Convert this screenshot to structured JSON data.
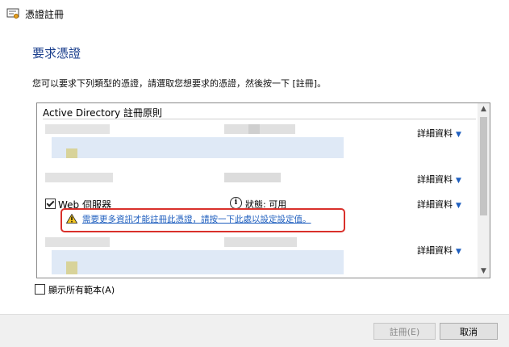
{
  "window": {
    "title": "憑證註冊"
  },
  "page": {
    "heading": "要求憑證",
    "description": "您可以要求下列類型的憑證，請選取您想要求的憑證，然後按一下 [註冊]。"
  },
  "list": {
    "header": "Active Directory 註冊原則",
    "details_label": "詳細資料",
    "web_server": {
      "name": "Web 伺服器",
      "status": "狀態: 可用",
      "checked": true,
      "warning": "需要更多資訊才能註冊此憑證，請按一下此處以設定設定值。"
    }
  },
  "options": {
    "show_all_templates": "顯示所有範本(A)"
  },
  "buttons": {
    "enroll": "註冊(E)",
    "cancel": "取消"
  },
  "colors": {
    "heading": "#1a3e8c",
    "link": "#1f5fbf",
    "highlight": "#d9302b"
  }
}
